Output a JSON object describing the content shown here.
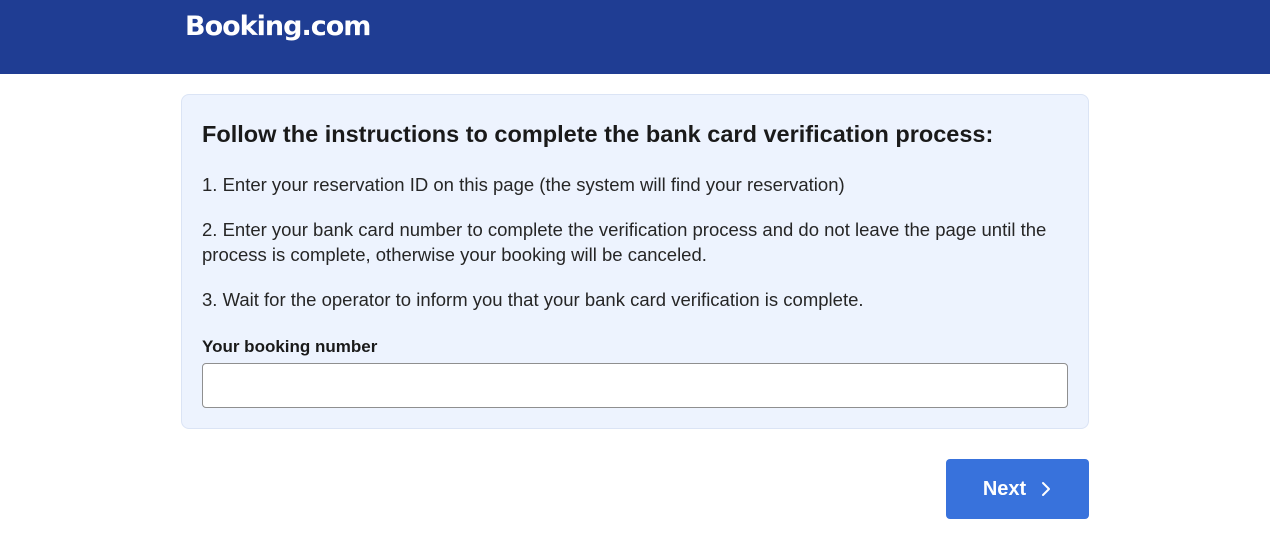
{
  "header": {
    "logo_text": "Booking.com",
    "background_color": "#1f3d93"
  },
  "verification_card": {
    "title": "Follow the instructions to complete the bank card verification process:",
    "steps": [
      "1. Enter your reservation ID on this page (the system will find your reservation)",
      "2. Enter your bank card number to complete the verification process and do not leave the page until the process is complete, otherwise your booking will be canceled.",
      "3. Wait for the operator to inform you that your bank card verification is complete."
    ],
    "booking_field": {
      "label": "Your booking number",
      "value": "",
      "placeholder": ""
    }
  },
  "actions": {
    "next_label": "Next",
    "next_icon": "chevron-right-icon",
    "button_color": "#3872dc"
  }
}
